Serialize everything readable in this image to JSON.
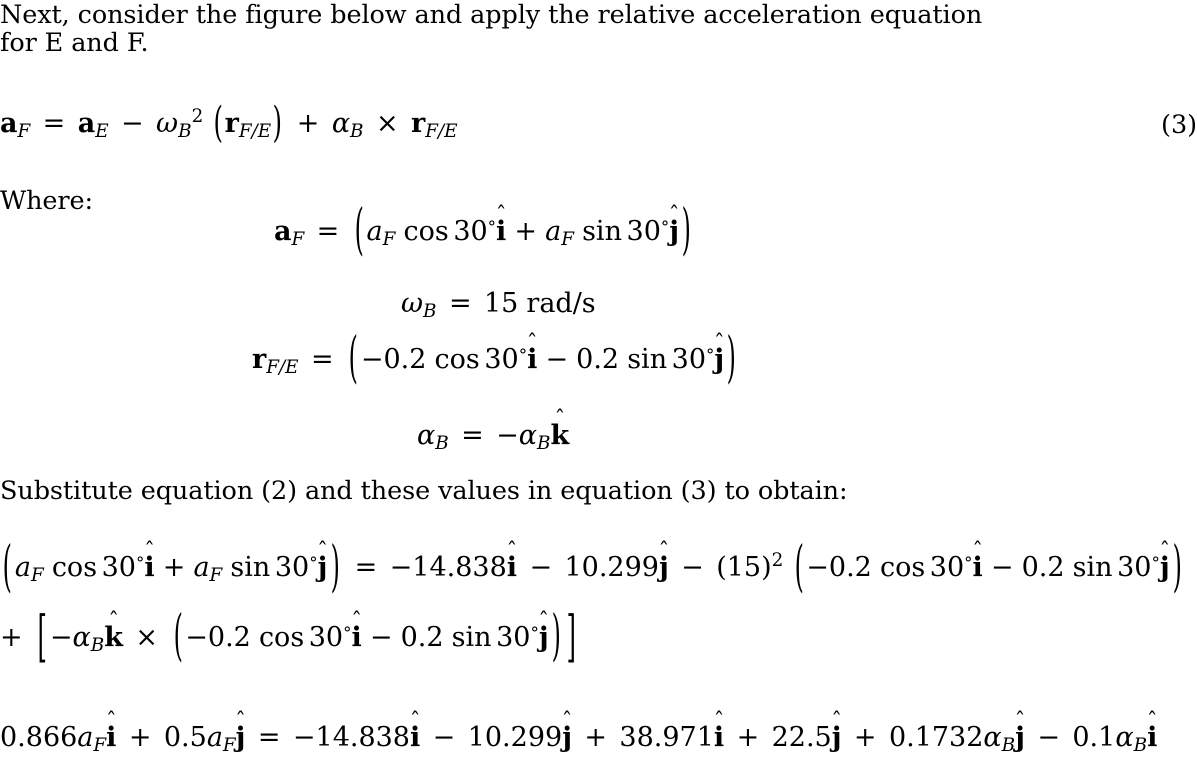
{
  "document": {
    "intro_paragraph": {
      "line1": "Next, consider the figure below and apply the relative acceleration equation",
      "line2": "for E and F."
    },
    "where_label": "Where:",
    "substitute_paragraph": "Substitute equation (2) and these values in equation (3) to obtain:",
    "equation_3_number": "(3)"
  },
  "equations": {
    "eq3": {
      "id": "relative-acceleration-equation",
      "plain": "a_F = a_E - omega_B^2 ( r_F/E ) + alpha_B x r_F/E",
      "lhs_vector": "a",
      "lhs_sub": "F",
      "equals": "=",
      "term1_vector": "a",
      "term1_sub": "E",
      "minus": "−",
      "omega": "ω",
      "omega_sub": "B",
      "omega_power": "2",
      "r_vector": "r",
      "r_sub": "F/E",
      "plus": "+",
      "alpha": "α",
      "alpha_sub": "B",
      "cross": "×"
    },
    "eq_af": {
      "id": "acceleration-of-F-definition",
      "plain": "a_F = ( a_F cos 30 i-hat + a_F sin 30 j-hat )",
      "lhs_vector": "a",
      "lhs_sub": "F",
      "equals": "=",
      "scalar": "a",
      "scalar_sub": "F",
      "cos": "cos",
      "sin": "sin",
      "angle": "30",
      "degree": "°",
      "i_hat": "i",
      "j_hat": "j",
      "hat_mark": "ˆ",
      "plus": "+"
    },
    "eq_omega": {
      "id": "angular-velocity-value",
      "plain": "omega_B = 15 rad/s",
      "omega": "ω",
      "omega_sub": "B",
      "equals": "=",
      "value": "15",
      "units": "rad/s"
    },
    "eq_rfe": {
      "id": "position-vector-F-relative-E",
      "plain": "r_F/E = ( -0.2 cos 30 i-hat - 0.2 sin 30 j-hat )",
      "r_vector": "r",
      "r_sub": "F/E",
      "equals": "=",
      "minus": "−",
      "magnitude": "0.2",
      "cos": "cos",
      "sin": "sin",
      "angle": "30",
      "degree": "°",
      "i_hat": "i",
      "j_hat": "j",
      "hat_mark": "ˆ"
    },
    "eq_alpha": {
      "id": "angular-acceleration-definition",
      "plain": "alpha_B = -alpha_B k-hat",
      "alpha": "α",
      "alpha_sub": "B",
      "equals": "=",
      "minus": "−",
      "k_hat": "k",
      "hat_mark": "ˆ"
    },
    "eq_big": {
      "id": "substituted-acceleration-equation",
      "plain_line1": "( a_F cos 30 i-hat + a_F sin 30 j-hat ) = -14.838 i-hat - 10.299 j-hat - (15)^2 ( -0.2 cos 30 i-hat - 0.2 sin 30 j-hat )",
      "plain_line2": "+ [ -alpha_B k-hat x ( -0.2 cos 30 i-hat - 0.2 sin 30 j-hat ) ]",
      "scalar": "a",
      "scalar_sub": "F",
      "cos": "cos",
      "sin": "sin",
      "angle": "30",
      "degree": "°",
      "i_hat": "i",
      "j_hat": "j",
      "k_hat": "k",
      "hat_mark": "ˆ",
      "equals": "=",
      "plus": "+",
      "minus": "−",
      "cross": "×",
      "aE_i_component": "14.838",
      "aE_j_component": "10.299",
      "omega_value": "15",
      "omega_power": "2",
      "r_magnitude": "0.2",
      "alpha": "α",
      "alpha_sub": "B"
    },
    "eq_final": {
      "id": "expanded-component-equation",
      "plain": "0.866 a_F i-hat + 0.5 a_F j-hat = -14.838 i-hat - 10.299 j-hat + 38.971 i-hat + 22.5 j-hat + 0.1732 alpha_B j-hat - 0.1 alpha_B i-hat",
      "cos30_coeff": "0.866",
      "sin30_coeff": "0.5",
      "scalar": "a",
      "scalar_sub": "F",
      "i_hat": "i",
      "j_hat": "j",
      "hat_mark": "ˆ",
      "equals": "=",
      "plus": "+",
      "minus": "−",
      "aE_i_component": "14.838",
      "aE_j_component": "10.299",
      "centripetal_i": "38.971",
      "centripetal_j": "22.5",
      "alpha_j_coeff": "0.1732",
      "alpha_i_coeff": "0.1",
      "alpha": "α",
      "alpha_sub": "B"
    }
  }
}
